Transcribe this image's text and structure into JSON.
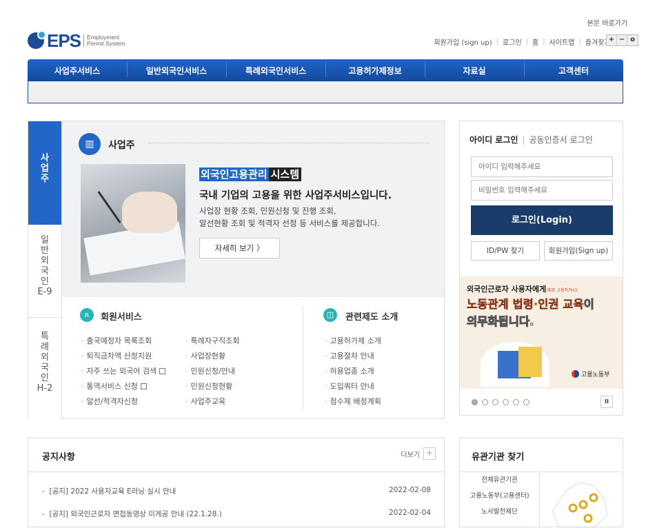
{
  "header": {
    "skip_link": "본문 바로가기",
    "logo": {
      "brand": "EPS",
      "sub1": "Employment",
      "sub2": "Permit System"
    },
    "util": [
      "회원가입 (sign up)",
      "로그인",
      "홈",
      "사이트맵",
      "즐겨찾기추가"
    ],
    "zoom": [
      "+",
      "−",
      "o"
    ]
  },
  "nav": [
    "사업주서비스",
    "일반외국인서비스",
    "특례외국인서비스",
    "고용허가제정보",
    "자료실",
    "고객센터"
  ],
  "side_tabs": [
    "사\n업\n주",
    "일\n반\n외\n국\n인\nE-9",
    "특\n례\n외\n국\n인\nH-2"
  ],
  "main": {
    "section_icon": "building-icon",
    "section_title": "사업주",
    "headline_a": "외국인고용관리",
    "headline_b": "시스템",
    "subheadline": "국내 기업의 고용을 위한 사업주서비스입니다.",
    "desc1": "사업장 현황 조회, 민원신청 및 진행 조회,",
    "desc2": "알선현황 조회 및 적격자 선정 등 서비스를 제공합니다.",
    "more_button": "자세히 보기  〉"
  },
  "member": {
    "title": "회원서비스",
    "col1": [
      "출국예정자 목록조회",
      "퇴직금차액 산정지원",
      "자주 쓰는 외국어 검색",
      "통역서비스 신청",
      "알선/적격자신청"
    ],
    "col2": [
      "특례자구직조회",
      "사업장현황",
      "민원신청/안내",
      "민원신청현황",
      "사업주교육"
    ]
  },
  "system": {
    "title": "관련제도 소개",
    "items": [
      "고용허가제 소개",
      "고용절차 안내",
      "허용업종 소개",
      "도입쿼터 안내",
      "점수제 배정계획"
    ]
  },
  "login": {
    "tab_id": "아이디 로그인",
    "tab_cert": "공동인증서 로그인",
    "id_placeholder": "아이디 입력해주세요",
    "pw_placeholder": "비밀번호 입력해주세요",
    "login_button": "로그인(Login)",
    "find_button": "ID/PW 찾기",
    "signup_button": "회원가입(Sign up)"
  },
  "banner": {
    "line1": "외국인근로자 사용자에게",
    "line1_small": "(최초 고용허가시)",
    "line2a": "노동관계 법령·인권 교육",
    "line2b": "이",
    "line3": "의무화됩니다.",
    "ministry": "고용노동부",
    "slides": 6,
    "pause": "II"
  },
  "notice": {
    "title": "공지사항",
    "more": "더보기",
    "items": [
      {
        "title": "[공지] 2022 사용자교육 E러닝 실시 안내",
        "date": "2022-02-08"
      },
      {
        "title": "[공지] 외국인근로자 면접동영상 미게공 안내 (22.1.28.)",
        "date": "2022-02-04"
      }
    ]
  },
  "related": {
    "title": "유관기관 찾기",
    "items": [
      "전체유관기관",
      "고용노동부(고용센터)",
      "노사발전재단"
    ]
  }
}
